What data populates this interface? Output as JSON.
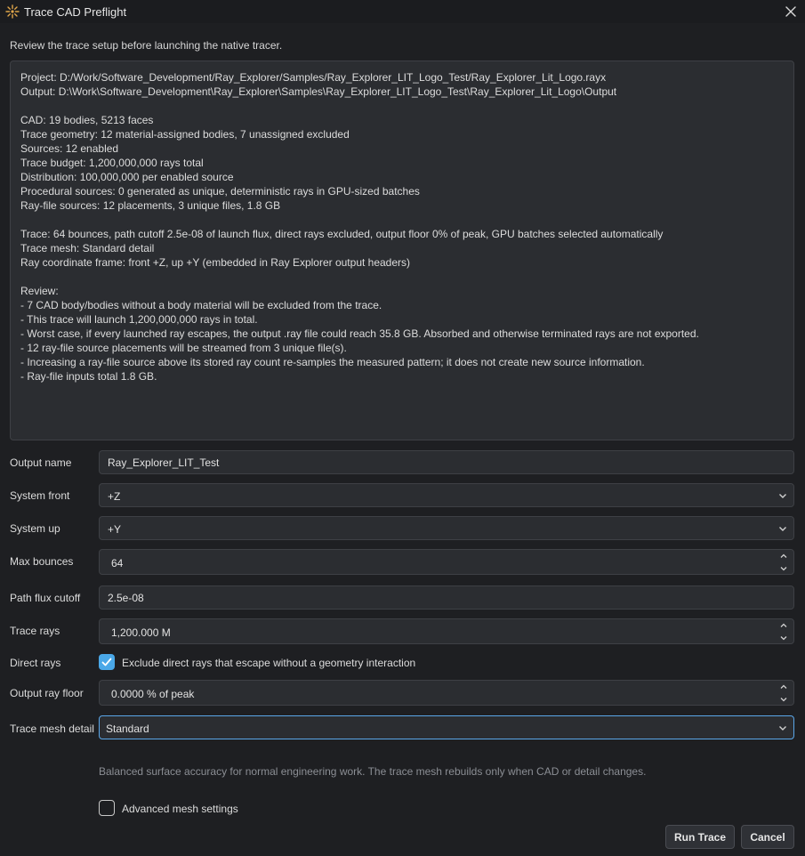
{
  "window": {
    "title": "Trace CAD Preflight"
  },
  "intro": "Review the trace setup before launching the native tracer.",
  "summary": {
    "block1": [
      "Project: D:/Work/Software_Development/Ray_Explorer/Samples/Ray_Explorer_LIT_Logo_Test/Ray_Explorer_Lit_Logo.rayx",
      "Output: D:\\Work\\Software_Development\\Ray_Explorer\\Samples\\Ray_Explorer_LIT_Logo_Test\\Ray_Explorer_Lit_Logo\\Output"
    ],
    "block2": [
      "CAD: 19 bodies, 5213 faces",
      "Trace geometry: 12 material-assigned bodies, 7 unassigned excluded",
      "Sources: 12 enabled",
      "Trace budget: 1,200,000,000 rays total",
      "Distribution: 100,000,000 per enabled source",
      "Procedural sources: 0 generated as unique, deterministic rays in GPU-sized batches",
      "Ray-file sources: 12 placements, 3 unique files, 1.8 GB"
    ],
    "block3": [
      "Trace: 64 bounces, path cutoff 2.5e-08 of launch flux, direct rays excluded, output floor 0% of peak, GPU batches selected automatically",
      "Trace mesh: Standard detail",
      "Ray coordinate frame: front +Z, up +Y (embedded in Ray Explorer output headers)"
    ],
    "block4": [
      "Review:",
      "- 7 CAD body/bodies without a body material will be excluded from the trace.",
      "- This trace will launch 1,200,000,000 rays in total.",
      "- Worst case, if every launched ray escapes, the output .ray file could reach 35.8 GB. Absorbed and otherwise terminated rays are not exported.",
      "- 12 ray-file source placements will be streamed from 3 unique file(s).",
      "- Increasing a ray-file source above its stored ray count re-samples the measured pattern; it does not create new source information.",
      "- Ray-file inputs total 1.8 GB."
    ]
  },
  "form": {
    "output_name": {
      "label": "Output name",
      "value": "Ray_Explorer_LIT_Test"
    },
    "system_front": {
      "label": "System front",
      "value": "+Z"
    },
    "system_up": {
      "label": "System up",
      "value": "+Y"
    },
    "max_bounces": {
      "label": "Max bounces",
      "value": "64"
    },
    "path_flux_cutoff": {
      "label": "Path flux cutoff",
      "value": "2.5e-08"
    },
    "trace_rays": {
      "label": "Trace rays",
      "value": "1,200.000 M"
    },
    "direct_rays": {
      "label": "Direct rays",
      "checkbox_label": "Exclude direct rays that escape without a geometry interaction",
      "checked": true
    },
    "output_ray_floor": {
      "label": "Output ray floor",
      "value": "0.0000 % of peak"
    },
    "trace_mesh_detail": {
      "label": "Trace mesh detail",
      "value": "Standard"
    },
    "mesh_hint": "Balanced surface accuracy for normal engineering work. The trace mesh rebuilds only when CAD or detail changes.",
    "advanced_mesh": {
      "label": "Advanced mesh settings",
      "checked": false
    }
  },
  "buttons": {
    "run": "Run Trace",
    "cancel": "Cancel"
  },
  "colors": {
    "accent": "#4aa8e8",
    "background": "#1e1f22",
    "panel": "#2b2d31",
    "icon_gold": "#e0a64a"
  }
}
